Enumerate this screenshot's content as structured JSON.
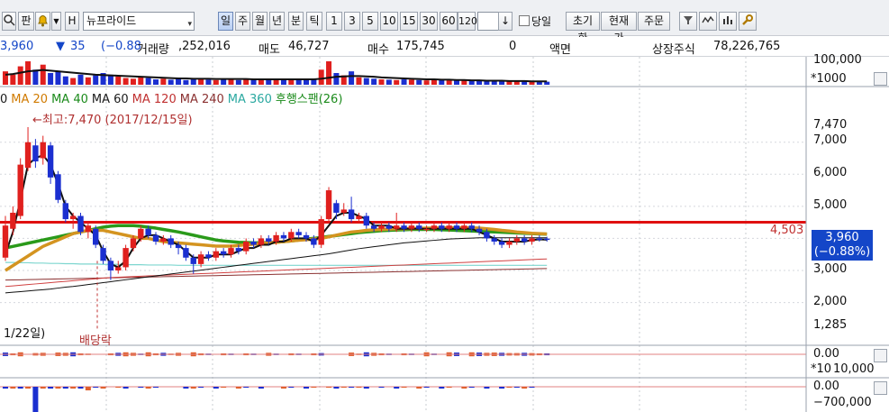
{
  "toolbar": {
    "buttons": [
      "판",
      "H"
    ],
    "stock_name": "뉴프라이드",
    "periods": [
      "일",
      "주",
      "월",
      "년",
      "분",
      "틱"
    ],
    "selected_period": "일",
    "intervals": [
      "1",
      "3",
      "5",
      "10",
      "15",
      "30",
      "60",
      "120"
    ],
    "down_arrow": "↓",
    "same_day_label": "당일",
    "actions": [
      "초기화",
      "현재가",
      "주문"
    ]
  },
  "info": {
    "price": "3,960",
    "change_arrow": "▼",
    "change": "35",
    "change_pct": "(−0.88",
    "volume_label": "거래량",
    "volume": ",252,016",
    "sell_label": "매도",
    "sell_qty": "46,727",
    "buy_label": "매수",
    "buy_qty": "175,745",
    "zero": "0",
    "par_label": "액면",
    "listed_label": "상장주식",
    "listed_qty": "78,226,765"
  },
  "legend": [
    {
      "text": "0",
      "color": "#1a1a1a"
    },
    {
      "text": "MA 20",
      "color": "#d07a00"
    },
    {
      "text": "MA 40",
      "color": "#1a8a1a"
    },
    {
      "text": "MA 60",
      "color": "#1a1a1a"
    },
    {
      "text": "MA 120",
      "color": "#c03030"
    },
    {
      "text": "MA 240",
      "color": "#8a3030"
    },
    {
      "text": "MA 360",
      "color": "#2aa8a0"
    },
    {
      "text": "후행스팬(26)",
      "color": "#1a8a1a"
    }
  ],
  "annotations": {
    "high": "←최고:7,470 (2017/12/15일)",
    "low": "1/22일)",
    "dividend": "배당락",
    "line_value": "4,503"
  },
  "price_tag": {
    "price": "3,960",
    "pct": "(−0.88%)"
  },
  "volume_axis": {
    "top": "100,000",
    "scale": "*1000"
  },
  "price_axis": [
    "7,470",
    "7,000",
    "6,000",
    "5,000",
    "3,000",
    "2,000",
    "1,285"
  ],
  "sub1_axis": {
    "zero": "0.00",
    "scale": "*10",
    "value": "10,000"
  },
  "sub2_axis": {
    "zero": "0.00",
    "value": "−700,000"
  },
  "chart_data": {
    "type": "candlestick",
    "ylim": [
      1285,
      7470
    ],
    "resistance": 4503,
    "current": 3960,
    "candles": [
      {
        "o": 3400,
        "c": 4400,
        "h": 4700,
        "l": 3300
      },
      {
        "o": 4300,
        "c": 4800,
        "h": 5000,
        "l": 4100
      },
      {
        "o": 4700,
        "c": 6300,
        "h": 6500,
        "l": 4600
      },
      {
        "o": 6200,
        "c": 7000,
        "h": 7470,
        "l": 6100
      },
      {
        "o": 6900,
        "c": 6400,
        "h": 7100,
        "l": 6200
      },
      {
        "o": 6500,
        "c": 7000,
        "h": 7200,
        "l": 6300
      },
      {
        "o": 6900,
        "c": 5900,
        "h": 7000,
        "l": 5700
      },
      {
        "o": 6000,
        "c": 5200,
        "h": 6100,
        "l": 5100
      },
      {
        "o": 5100,
        "c": 4600,
        "h": 5200,
        "l": 4500
      },
      {
        "o": 4600,
        "c": 4700,
        "h": 4800,
        "l": 4300
      },
      {
        "o": 4700,
        "c": 4200,
        "h": 4800,
        "l": 4100
      },
      {
        "o": 4200,
        "c": 4400,
        "h": 4500,
        "l": 4000
      },
      {
        "o": 4300,
        "c": 3800,
        "h": 4400,
        "l": 3700
      },
      {
        "o": 3700,
        "c": 3300,
        "h": 3800,
        "l": 3200
      },
      {
        "o": 3300,
        "c": 3000,
        "h": 3400,
        "l": 2700
      },
      {
        "o": 3000,
        "c": 3100,
        "h": 3300,
        "l": 2900
      },
      {
        "o": 3100,
        "c": 3700,
        "h": 3800,
        "l": 3000
      },
      {
        "o": 3700,
        "c": 4000,
        "h": 4100,
        "l": 3600
      },
      {
        "o": 4000,
        "c": 4300,
        "h": 4400,
        "l": 3900
      },
      {
        "o": 4300,
        "c": 4100,
        "h": 4400,
        "l": 4000
      },
      {
        "o": 4100,
        "c": 3900,
        "h": 4200,
        "l": 3800
      },
      {
        "o": 3900,
        "c": 4000,
        "h": 4100,
        "l": 3800
      },
      {
        "o": 4000,
        "c": 3800,
        "h": 4100,
        "l": 3700
      },
      {
        "o": 3800,
        "c": 3700,
        "h": 3900,
        "l": 3500
      },
      {
        "o": 3700,
        "c": 3400,
        "h": 3800,
        "l": 3300
      },
      {
        "o": 3400,
        "c": 3200,
        "h": 3500,
        "l": 2900
      },
      {
        "o": 3200,
        "c": 3500,
        "h": 3600,
        "l": 3100
      },
      {
        "o": 3500,
        "c": 3400,
        "h": 3600,
        "l": 3300
      },
      {
        "o": 3400,
        "c": 3600,
        "h": 3700,
        "l": 3300
      },
      {
        "o": 3600,
        "c": 3500,
        "h": 3700,
        "l": 3400
      },
      {
        "o": 3500,
        "c": 3700,
        "h": 3800,
        "l": 3400
      },
      {
        "o": 3700,
        "c": 3600,
        "h": 3800,
        "l": 3500
      },
      {
        "o": 3600,
        "c": 3900,
        "h": 4000,
        "l": 3500
      },
      {
        "o": 3900,
        "c": 3800,
        "h": 4000,
        "l": 3700
      },
      {
        "o": 3800,
        "c": 4000,
        "h": 4100,
        "l": 3700
      },
      {
        "o": 4000,
        "c": 3900,
        "h": 4100,
        "l": 3800
      },
      {
        "o": 3900,
        "c": 4100,
        "h": 4200,
        "l": 3800
      },
      {
        "o": 4100,
        "c": 4000,
        "h": 4200,
        "l": 3900
      },
      {
        "o": 4000,
        "c": 4200,
        "h": 4300,
        "l": 3900
      },
      {
        "o": 4200,
        "c": 4100,
        "h": 4300,
        "l": 4000
      },
      {
        "o": 4100,
        "c": 4000,
        "h": 4200,
        "l": 3900
      },
      {
        "o": 4000,
        "c": 3800,
        "h": 4100,
        "l": 3700
      },
      {
        "o": 3800,
        "c": 4600,
        "h": 4700,
        "l": 3700
      },
      {
        "o": 4600,
        "c": 5500,
        "h": 5600,
        "l": 4500
      },
      {
        "o": 5100,
        "c": 4800,
        "h": 5200,
        "l": 4600
      },
      {
        "o": 4800,
        "c": 4900,
        "h": 5100,
        "l": 4700
      },
      {
        "o": 4900,
        "c": 4600,
        "h": 5300,
        "l": 4500
      },
      {
        "o": 4600,
        "c": 4700,
        "h": 4800,
        "l": 4500
      },
      {
        "o": 4700,
        "c": 4400,
        "h": 4800,
        "l": 4300
      },
      {
        "o": 4400,
        "c": 4300,
        "h": 4500,
        "l": 4200
      },
      {
        "o": 4300,
        "c": 4400,
        "h": 4500,
        "l": 4200
      },
      {
        "o": 4400,
        "c": 4300,
        "h": 4500,
        "l": 4200
      },
      {
        "o": 4300,
        "c": 4400,
        "h": 4800,
        "l": 4200
      },
      {
        "o": 4400,
        "c": 4300,
        "h": 4500,
        "l": 4200
      },
      {
        "o": 4300,
        "c": 4400,
        "h": 4500,
        "l": 4200
      },
      {
        "o": 4400,
        "c": 4300,
        "h": 4500,
        "l": 4200
      },
      {
        "o": 4300,
        "c": 4300,
        "h": 4400,
        "l": 4200
      },
      {
        "o": 4300,
        "c": 4400,
        "h": 4500,
        "l": 4200
      },
      {
        "o": 4400,
        "c": 4300,
        "h": 4500,
        "l": 4200
      },
      {
        "o": 4300,
        "c": 4400,
        "h": 4500,
        "l": 4200
      },
      {
        "o": 4400,
        "c": 4300,
        "h": 4500,
        "l": 4200
      },
      {
        "o": 4300,
        "c": 4400,
        "h": 4500,
        "l": 4200
      },
      {
        "o": 4400,
        "c": 4300,
        "h": 4500,
        "l": 4200
      },
      {
        "o": 4300,
        "c": 4200,
        "h": 4400,
        "l": 4100
      },
      {
        "o": 4200,
        "c": 4000,
        "h": 4300,
        "l": 3900
      },
      {
        "o": 4000,
        "c": 3900,
        "h": 4100,
        "l": 3800
      },
      {
        "o": 3900,
        "c": 3800,
        "h": 4000,
        "l": 3700
      },
      {
        "o": 3800,
        "c": 3900,
        "h": 4000,
        "l": 3700
      },
      {
        "o": 3900,
        "c": 4000,
        "h": 4100,
        "l": 3800
      },
      {
        "o": 4000,
        "c": 3900,
        "h": 4100,
        "l": 3800
      },
      {
        "o": 3900,
        "c": 4000,
        "h": 4100,
        "l": 3800
      },
      {
        "o": 4000,
        "c": 3995,
        "h": 4100,
        "l": 3900
      },
      {
        "o": 3995,
        "c": 3960,
        "h": 4050,
        "l": 3900
      }
    ],
    "ma5": [
      3500,
      4200,
      5200,
      6300,
      6500,
      6600,
      6300,
      5700,
      5000,
      4700,
      4500,
      4300,
      4100,
      3600,
      3200,
      3100,
      3300,
      3700,
      4000,
      4100,
      4100,
      4000,
      3900,
      3800,
      3600,
      3400,
      3400,
      3400,
      3500,
      3500,
      3500,
      3600,
      3700,
      3700,
      3800,
      3800,
      3900,
      3900,
      4000,
      4000,
      4000,
      3900,
      4100,
      4400,
      4700,
      4800,
      4800,
      4700,
      4600,
      4400,
      4400,
      4400,
      4300,
      4300,
      4300,
      4300,
      4300,
      4300,
      4300,
      4300,
      4300,
      4300,
      4300,
      4200,
      4100,
      4000,
      3900,
      3900,
      3900,
      3900,
      3950,
      3970,
      3960
    ],
    "ma20": [
      3000,
      3150,
      3300,
      3450,
      3600,
      3750,
      3850,
      3950,
      4050,
      4150,
      4200,
      4250,
      4250,
      4250,
      4200,
      4150,
      4100,
      4050,
      4000,
      4000,
      3950,
      3900,
      3880,
      3860,
      3840,
      3820,
      3800,
      3780,
      3760,
      3760,
      3760,
      3780,
      3800,
      3820,
      3840,
      3860,
      3880,
      3900,
      3920,
      3940,
      3960,
      3980,
      4000,
      4050,
      4100,
      4150,
      4200,
      4220,
      4250,
      4270,
      4280,
      4290,
      4300,
      4300,
      4310,
      4310,
      4320,
      4320,
      4330,
      4330,
      4330,
      4330,
      4330,
      4320,
      4300,
      4280,
      4250,
      4230,
      4200,
      4180,
      4160,
      4150,
      4140
    ],
    "ma40": [
      3700,
      3750,
      3800,
      3850,
      3900,
      3950,
      4000,
      4050,
      4100,
      4150,
      4200,
      4250,
      4300,
      4350,
      4380,
      4400,
      4400,
      4400,
      4380,
      4350,
      4320,
      4280,
      4240,
      4200,
      4150,
      4100,
      4050,
      4000,
      3950,
      3920,
      3900,
      3880,
      3870,
      3860,
      3860,
      3870,
      3880,
      3900,
      3920,
      3950,
      3980,
      4000,
      4030,
      4060,
      4090,
      4120,
      4150,
      4180,
      4200,
      4220,
      4240,
      4250,
      4260,
      4270,
      4280,
      4280,
      4280,
      4280,
      4270,
      4260,
      4250,
      4240,
      4230,
      4220,
      4210,
      4200,
      4190,
      4180,
      4170,
      4160,
      4150,
      4140,
      4130
    ],
    "ma60": [
      2300,
      2320,
      2340,
      2360,
      2380,
      2400,
      2420,
      2450,
      2480,
      2500,
      2530,
      2560,
      2590,
      2620,
      2650,
      2680,
      2710,
      2740,
      2770,
      2800,
      2830,
      2860,
      2890,
      2920,
      2950,
      2980,
      3010,
      3040,
      3070,
      3100,
      3130,
      3160,
      3190,
      3220,
      3250,
      3280,
      3310,
      3340,
      3370,
      3400,
      3430,
      3460,
      3490,
      3520,
      3560,
      3600,
      3640,
      3680,
      3710,
      3740,
      3770,
      3800,
      3830,
      3860,
      3880,
      3900,
      3920,
      3940,
      3960,
      3980,
      3990,
      4000,
      4010,
      4020,
      4020,
      4020,
      4020,
      4020,
      4020,
      4020,
      4020,
      4020,
      4020
    ],
    "ma120": [
      2500,
      2520,
      2540,
      2560,
      2580,
      2600,
      2620,
      2640,
      2660,
      2680,
      2700,
      2720,
      2740,
      2760,
      2780,
      2790,
      2800,
      2810,
      2820,
      2830,
      2840,
      2850,
      2860,
      2870,
      2880,
      2890,
      2900,
      2910,
      2920,
      2930,
      2940,
      2950,
      2960,
      2970,
      2980,
      2990,
      3000,
      3010,
      3020,
      3030,
      3040,
      3050,
      3060,
      3070,
      3080,
      3090,
      3100,
      3110,
      3120,
      3130,
      3140,
      3150,
      3160,
      3170,
      3180,
      3190,
      3200,
      3210,
      3220,
      3230,
      3240,
      3250,
      3260,
      3270,
      3280,
      3290,
      3300,
      3310,
      3320,
      3330,
      3340,
      3350,
      3360
    ],
    "ma240": [
      2700,
      2705,
      2710,
      2715,
      2720,
      2725,
      2730,
      2735,
      2740,
      2745,
      2750,
      2755,
      2760,
      2765,
      2770,
      2775,
      2780,
      2785,
      2790,
      2795,
      2800,
      2805,
      2810,
      2815,
      2820,
      2825,
      2830,
      2835,
      2840,
      2845,
      2850,
      2855,
      2860,
      2865,
      2870,
      2875,
      2880,
      2885,
      2890,
      2895,
      2900,
      2905,
      2910,
      2915,
      2920,
      2925,
      2930,
      2935,
      2940,
      2945,
      2950,
      2955,
      2960,
      2965,
      2970,
      2975,
      2980,
      2985,
      2990,
      2995,
      3000,
      3005,
      3010,
      3015,
      3020,
      3025,
      3030,
      3035,
      3040,
      3045,
      3050,
      3055,
      3060
    ],
    "ma360": [
      3250,
      3250,
      3240,
      3240,
      3230,
      3230,
      3220,
      3220,
      3210,
      3210,
      3200,
      3200,
      3200,
      3190,
      3190,
      3190,
      3180,
      3180,
      3180,
      3170,
      3170,
      3170,
      3170,
      3160,
      3160,
      3160,
      3160,
      3160,
      3160,
      3160,
      3160,
      3160,
      3160,
      3160,
      3160,
      3160,
      3160,
      3160,
      3160,
      3160,
      3160,
      3160,
      3160,
      3160,
      3160,
      3160,
      3160,
      3160,
      3160,
      3160,
      3160,
      3160,
      3160,
      3160,
      3160,
      3160,
      3160,
      3160,
      3160,
      3160,
      3160,
      3160,
      3160,
      3160,
      3160,
      3160,
      3160,
      3160,
      3160,
      3160,
      3160,
      3160,
      3160
    ],
    "volume": [
      40,
      30,
      55,
      70,
      45,
      60,
      35,
      40,
      25,
      20,
      30,
      22,
      28,
      35,
      30,
      25,
      20,
      18,
      22,
      20,
      16,
      18,
      15,
      18,
      14,
      20,
      16,
      15,
      14,
      16,
      15,
      14,
      16,
      15,
      14,
      18,
      15,
      14,
      16,
      15,
      14,
      16,
      45,
      70,
      35,
      28,
      40,
      22,
      20,
      18,
      16,
      15,
      14,
      16,
      15,
      14,
      13,
      15,
      14,
      13,
      12,
      14,
      13,
      12,
      11,
      12,
      11,
      10,
      10,
      11,
      10,
      9,
      9
    ],
    "volume_ma": [
      30,
      32,
      36,
      40,
      42,
      44,
      42,
      40,
      38,
      36,
      34,
      32,
      30,
      29,
      28,
      27,
      26,
      25,
      24,
      23,
      22,
      21,
      20,
      19,
      19,
      18,
      18,
      18,
      17,
      17,
      17,
      17,
      17,
      16,
      16,
      16,
      16,
      16,
      16,
      16,
      16,
      16,
      18,
      21,
      24,
      25,
      26,
      26,
      25,
      24,
      22,
      21,
      20,
      19,
      18,
      17,
      16,
      16,
      15,
      15,
      14,
      14,
      13,
      13,
      12,
      12,
      12,
      11,
      11,
      11,
      10,
      10,
      10
    ]
  }
}
